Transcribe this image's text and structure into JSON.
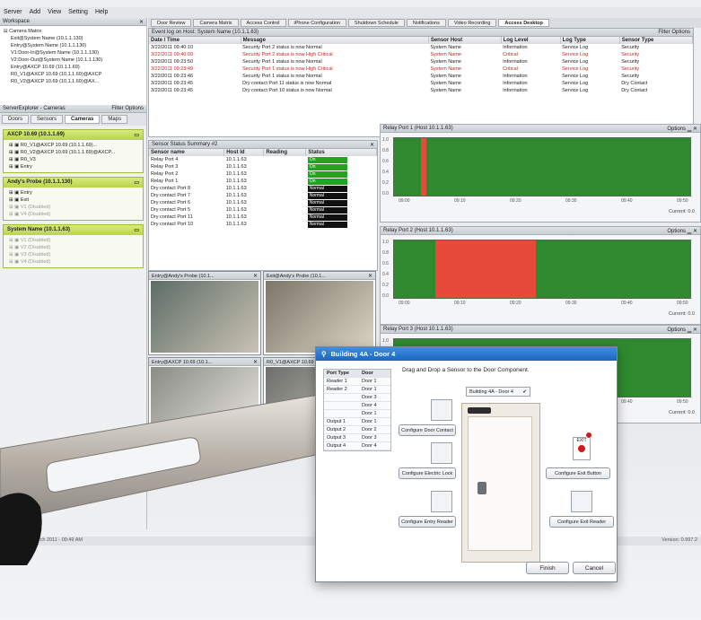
{
  "menu": [
    "Server",
    "Add",
    "View",
    "Setting",
    "Help"
  ],
  "left": {
    "workspace_title": "Workspace",
    "tree": [
      "Camera Matrix",
      "Exit@System Name (10.1.1.130)",
      "Entry@System Name (10.1.1.130)",
      "V1:Door-In@System Name (10.1.1.130)",
      "V2:Door-Out@System Name (10.1.1.130)",
      "Entry@AXCP 10.69 (10.1.1.69)",
      "R0_V1@AXCP 10.69 (10.1.1.69)@AXCP",
      "R0_V2@AXCP 10.69 (10.1.1.69)@AX..."
    ],
    "explorer_title": "ServerExplorer - Cameras",
    "explorer_opts": "Filter Options",
    "tabs": [
      "Doors",
      "Sensors",
      "Cameras",
      "Maps"
    ],
    "groups": [
      {
        "name": "AXCP 10.69 (10.1.1.69)",
        "items": [
          "R0_V1@AXCP 10.69 (10.1.1.69)...",
          "R0_V2@AXCP 10.69 (10.1.1.69)@AXCP...",
          "R0_V3",
          "Entry"
        ]
      },
      {
        "name": "Andy's Probe (10.1.1.130)",
        "items": [
          "Entry",
          "Exit",
          "V1 (Disabled)",
          "V4 (Disabled)"
        ]
      },
      {
        "name": "System Name (10.1.1.63)",
        "items": [
          "V1 (Disabled)",
          "V2 (Disabled)",
          "V3 (Disabled)",
          "V4 (Disabled)"
        ]
      }
    ]
  },
  "tabs": [
    "Door Review",
    "Camera Matrix",
    "Access Control",
    "iPhone Configuration",
    "Shutdown Schedule",
    "Notifications",
    "Video Recording",
    "Access Desktop"
  ],
  "events": {
    "title": "Event log on Host: System Name (10.1.1.63)",
    "filter": "Filter Options",
    "columns": [
      "Date / Time",
      "Message",
      "Sensor Host",
      "Log Level",
      "Log Type",
      "Sensor Type"
    ],
    "rows": [
      [
        "3/22/2011 09:40:10",
        "Security Port 2 status is now Normal",
        "System Name",
        "Information",
        "Service Log",
        "Security"
      ],
      [
        "3/22/2011 09:40:09",
        "Security Port 2 status is now High Critical",
        "System Name",
        "Critical",
        "Service Log",
        "Security"
      ],
      [
        "3/22/2011 09:23:50",
        "Security Port 1 status is now Normal",
        "System Name",
        "Information",
        "Service Log",
        "Security"
      ],
      [
        "3/22/2011 09:23:49",
        "Security Port 1 status is now High Critical",
        "System Name",
        "Critical",
        "Service Log",
        "Security"
      ],
      [
        "3/22/2011 09:23:46",
        "Security Port 1 status is now Normal",
        "System Name",
        "Information",
        "Service Log",
        "Security"
      ],
      [
        "3/22/2011 09:23:45",
        "Dry contact Port 11 status is now Normal",
        "System Name",
        "Information",
        "Service Log",
        "Dry Contact"
      ],
      [
        "3/22/2011 09:23:45",
        "Dry contact Port 10 status is now Normal",
        "System Name",
        "Information",
        "Service Log",
        "Dry Contact"
      ]
    ]
  },
  "summary": {
    "title": "Sensor Status Summary #2",
    "columns": [
      "Sensor name",
      "Host Id",
      "Reading",
      "Status"
    ],
    "rows": [
      [
        "Relay Port 4",
        "10.1.1.63",
        "",
        "On"
      ],
      [
        "Relay Port 3",
        "10.1.1.63",
        "",
        "On"
      ],
      [
        "Relay Port 2",
        "10.1.1.63",
        "",
        "On"
      ],
      [
        "Relay Port 1",
        "10.1.1.63",
        "",
        "On"
      ],
      [
        "Dry contact Port 8",
        "10.1.1.63",
        "",
        "Normal"
      ],
      [
        "Dry contact Port 7",
        "10.1.1.63",
        "",
        "Normal"
      ],
      [
        "Dry contact Port 6",
        "10.1.1.63",
        "",
        "Normal"
      ],
      [
        "Dry contact Port 5",
        "10.1.1.63",
        "",
        "Normal"
      ],
      [
        "Dry contact Port 11",
        "10.1.1.63",
        "",
        "Normal"
      ],
      [
        "Dry contact Port 10",
        "10.1.1.63",
        "",
        "Normal"
      ]
    ]
  },
  "cams": [
    "Entry@Andy's Probe (10.1...",
    "Exit@Andy's Probe (10.1...",
    "Entry@AXCP 10.69 (10.1...",
    "R0_V1@AXCP 10.69 (10.1..."
  ],
  "relays": [
    {
      "title": "Relay Port 1 (Host 10.1.1.63)",
      "current": "Current: 0.0",
      "red_from": 0.09,
      "red_to": 0.11
    },
    {
      "title": "Relay Port 2 (Host 10.1.1.63)",
      "current": "Current: 0.0",
      "red_from": 0.14,
      "red_to": 0.48
    },
    {
      "title": "Relay Port 3 (Host 10.1.1.63)",
      "current": "Current: 0.0",
      "red_from": 0,
      "red_to": 0
    }
  ],
  "relay_yticks": [
    "1.0",
    "0.8",
    "0.6",
    "0.4",
    "0.2",
    "0.0"
  ],
  "relay_xticks": [
    "09:00",
    "09:10",
    "09:20",
    "09:30",
    "09:40",
    "09:50"
  ],
  "status": {
    "left": "Tuesday, 22 March 2011 - 09:49 AM",
    "right": "Version: 0.997.2"
  },
  "dialog": {
    "title": "Building 4A - Door 4",
    "instruction": "Drag and Drop a Sensor to the Door Component.",
    "port_cols": [
      "Port Type",
      "Door"
    ],
    "ports": [
      [
        "Reader 1",
        "Door 1"
      ],
      [
        "Reader 2",
        "Door 1"
      ],
      [
        "",
        "Door 3"
      ],
      [
        "",
        "Door 4"
      ],
      [
        "",
        "Door 1"
      ],
      [
        "Output 1",
        "Door 1"
      ],
      [
        "Output 2",
        "Door 2"
      ],
      [
        "Output 3",
        "Door 3"
      ],
      [
        "Output 4",
        "Door 4"
      ]
    ],
    "door_select": "Building 4A - Door 4",
    "buttons": [
      "Configure Door Contact",
      "Configure Electric Lock",
      "Configure Entry Reader",
      "Configure Exit Button",
      "Configure Exit Reader"
    ],
    "exit_label": "EXIT",
    "finish": "Finish",
    "cancel": "Cancel"
  }
}
